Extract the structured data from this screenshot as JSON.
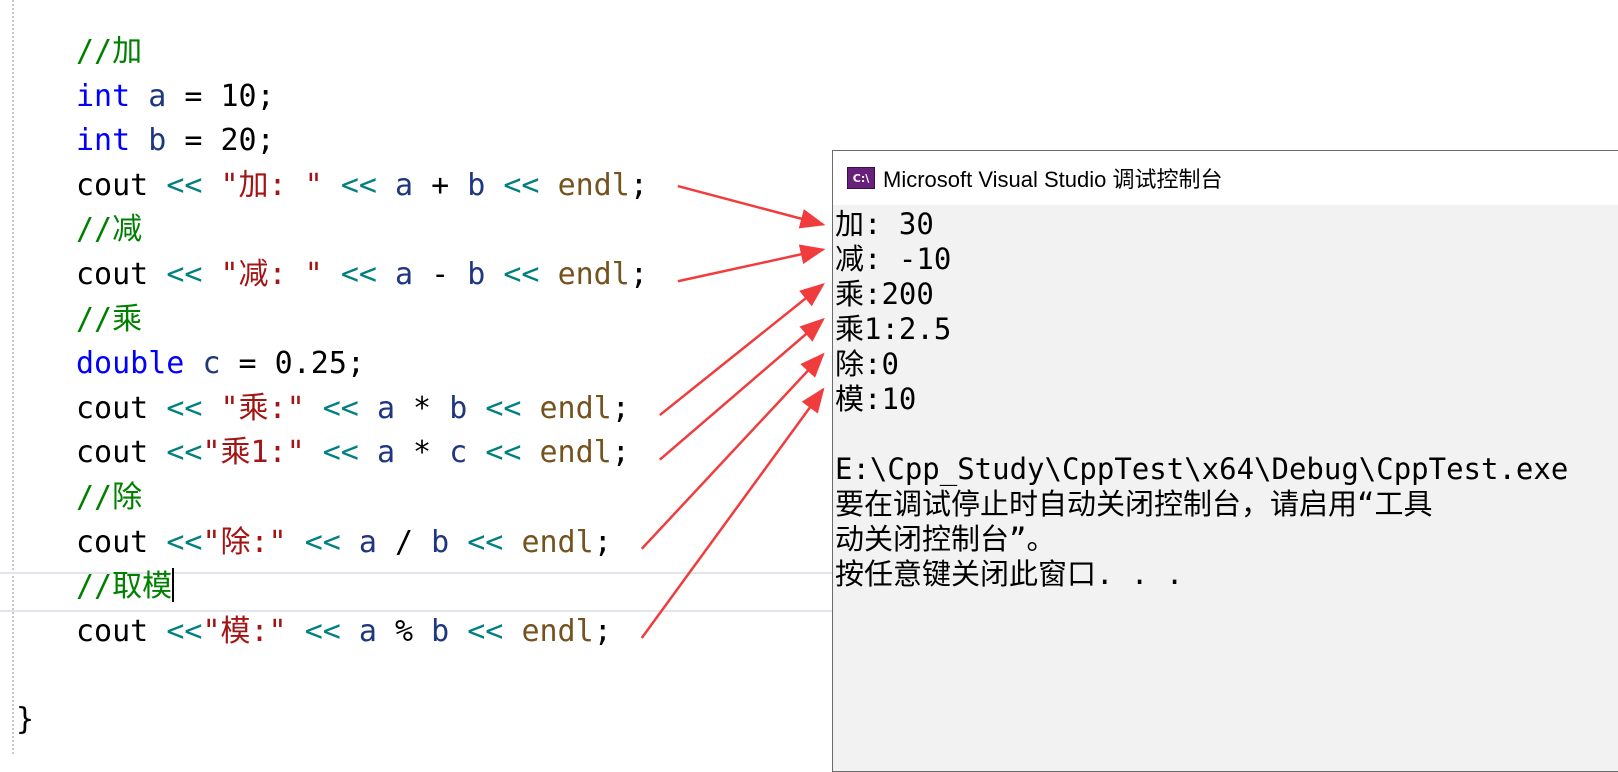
{
  "editor": {
    "lines": [
      [
        {
          "c": "cm",
          "t": "//加"
        }
      ],
      [
        {
          "c": "kw",
          "t": "int"
        },
        {
          "c": "tx",
          "t": " "
        },
        {
          "c": "id",
          "t": "a"
        },
        {
          "c": "tx",
          "t": " = 10;"
        }
      ],
      [
        {
          "c": "kw",
          "t": "int"
        },
        {
          "c": "tx",
          "t": " "
        },
        {
          "c": "id",
          "t": "b"
        },
        {
          "c": "tx",
          "t": " = 20;"
        }
      ],
      [
        {
          "c": "tx",
          "t": "cout "
        },
        {
          "c": "op",
          "t": "<<"
        },
        {
          "c": "tx",
          "t": " "
        },
        {
          "c": "str",
          "t": "\"加: \""
        },
        {
          "c": "tx",
          "t": " "
        },
        {
          "c": "op",
          "t": "<<"
        },
        {
          "c": "tx",
          "t": " "
        },
        {
          "c": "id",
          "t": "a"
        },
        {
          "c": "tx",
          "t": " + "
        },
        {
          "c": "id",
          "t": "b"
        },
        {
          "c": "tx",
          "t": " "
        },
        {
          "c": "op",
          "t": "<<"
        },
        {
          "c": "tx",
          "t": " "
        },
        {
          "c": "fn",
          "t": "endl"
        },
        {
          "c": "tx",
          "t": ";"
        }
      ],
      [
        {
          "c": "cm",
          "t": "//减"
        }
      ],
      [
        {
          "c": "tx",
          "t": "cout "
        },
        {
          "c": "op",
          "t": "<<"
        },
        {
          "c": "tx",
          "t": " "
        },
        {
          "c": "str",
          "t": "\"减: \""
        },
        {
          "c": "tx",
          "t": " "
        },
        {
          "c": "op",
          "t": "<<"
        },
        {
          "c": "tx",
          "t": " "
        },
        {
          "c": "id",
          "t": "a"
        },
        {
          "c": "tx",
          "t": " - "
        },
        {
          "c": "id",
          "t": "b"
        },
        {
          "c": "tx",
          "t": " "
        },
        {
          "c": "op",
          "t": "<<"
        },
        {
          "c": "tx",
          "t": " "
        },
        {
          "c": "fn",
          "t": "endl"
        },
        {
          "c": "tx",
          "t": ";"
        }
      ],
      [
        {
          "c": "cm",
          "t": "//乘"
        }
      ],
      [
        {
          "c": "kw",
          "t": "double"
        },
        {
          "c": "tx",
          "t": " "
        },
        {
          "c": "id",
          "t": "c"
        },
        {
          "c": "tx",
          "t": " = 0.25;"
        }
      ],
      [
        {
          "c": "tx",
          "t": "cout "
        },
        {
          "c": "op",
          "t": "<<"
        },
        {
          "c": "tx",
          "t": " "
        },
        {
          "c": "str",
          "t": "\"乘:\""
        },
        {
          "c": "tx",
          "t": " "
        },
        {
          "c": "op",
          "t": "<<"
        },
        {
          "c": "tx",
          "t": " "
        },
        {
          "c": "id",
          "t": "a"
        },
        {
          "c": "tx",
          "t": " * "
        },
        {
          "c": "id",
          "t": "b"
        },
        {
          "c": "tx",
          "t": " "
        },
        {
          "c": "op",
          "t": "<<"
        },
        {
          "c": "tx",
          "t": " "
        },
        {
          "c": "fn",
          "t": "endl"
        },
        {
          "c": "tx",
          "t": ";"
        }
      ],
      [
        {
          "c": "tx",
          "t": "cout "
        },
        {
          "c": "op",
          "t": "<<"
        },
        {
          "c": "str",
          "t": "\"乘1:\""
        },
        {
          "c": "tx",
          "t": " "
        },
        {
          "c": "op",
          "t": "<<"
        },
        {
          "c": "tx",
          "t": " "
        },
        {
          "c": "id",
          "t": "a"
        },
        {
          "c": "tx",
          "t": " * "
        },
        {
          "c": "id",
          "t": "c"
        },
        {
          "c": "tx",
          "t": " "
        },
        {
          "c": "op",
          "t": "<<"
        },
        {
          "c": "tx",
          "t": " "
        },
        {
          "c": "fn",
          "t": "endl"
        },
        {
          "c": "tx",
          "t": ";"
        }
      ],
      [
        {
          "c": "cm",
          "t": "//除"
        }
      ],
      [
        {
          "c": "tx",
          "t": "cout "
        },
        {
          "c": "op",
          "t": "<<"
        },
        {
          "c": "str",
          "t": "\"除:\""
        },
        {
          "c": "tx",
          "t": " "
        },
        {
          "c": "op",
          "t": "<<"
        },
        {
          "c": "tx",
          "t": " "
        },
        {
          "c": "id",
          "t": "a"
        },
        {
          "c": "tx",
          "t": " / "
        },
        {
          "c": "id",
          "t": "b"
        },
        {
          "c": "tx",
          "t": " "
        },
        {
          "c": "op",
          "t": "<<"
        },
        {
          "c": "tx",
          "t": " "
        },
        {
          "c": "fn",
          "t": "endl"
        },
        {
          "c": "tx",
          "t": ";"
        }
      ],
      [
        {
          "c": "cm",
          "t": "//取模"
        }
      ],
      [
        {
          "c": "tx",
          "t": "cout "
        },
        {
          "c": "op",
          "t": "<<"
        },
        {
          "c": "str",
          "t": "\"模:\""
        },
        {
          "c": "tx",
          "t": " "
        },
        {
          "c": "op",
          "t": "<<"
        },
        {
          "c": "tx",
          "t": " "
        },
        {
          "c": "id",
          "t": "a"
        },
        {
          "c": "tx",
          "t": " % "
        },
        {
          "c": "id",
          "t": "b"
        },
        {
          "c": "tx",
          "t": " "
        },
        {
          "c": "op",
          "t": "<<"
        },
        {
          "c": "tx",
          "t": " "
        },
        {
          "c": "fn",
          "t": "endl"
        },
        {
          "c": "tx",
          "t": ";"
        }
      ],
      [],
      []
    ],
    "closing_brace": "}",
    "caret_line": 12
  },
  "console": {
    "title": "Microsoft Visual Studio 调试控制台",
    "icon_label": "C:\\",
    "output": [
      "加: 30",
      "减: -10",
      "乘:200",
      "乘1:2.5",
      "除:0",
      "模:10",
      "",
      "E:\\Cpp_Study\\CppTest\\x64\\Debug\\CppTest.exe",
      "要在调试停止时自动关闭控制台，请启用“工具",
      "动关闭控制台”。",
      "按任意键关闭此窗口. . ."
    ]
  },
  "annotation": {
    "arrow_color": "#f03c3c",
    "arrows": [
      {
        "from_line": 3,
        "to_output": 0
      },
      {
        "from_line": 5,
        "to_output": 1
      },
      {
        "from_line": 8,
        "to_output": 2
      },
      {
        "from_line": 9,
        "to_output": 3
      },
      {
        "from_line": 11,
        "to_output": 4
      },
      {
        "from_line": 13,
        "to_output": 5
      }
    ]
  }
}
